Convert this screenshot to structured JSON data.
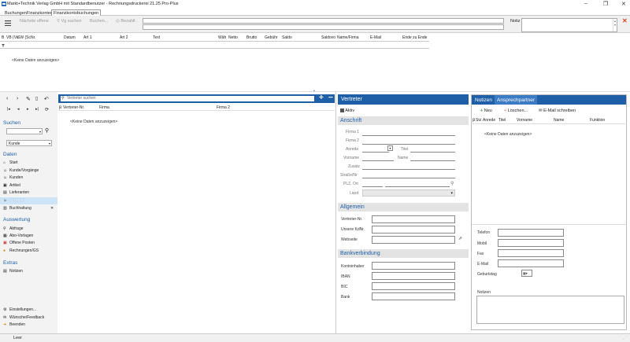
{
  "window": {
    "title": "Markt+Technik Verlag GmbH mit Standardbenutzer  -  Rechnungsdruckerei 21.25 Pro-Plus",
    "minimize": "–",
    "maximize": "❐",
    "close": "✕"
  },
  "tabs": [
    "Buchungen",
    "Finanzkonten",
    "Finanzkontobuchungen"
  ],
  "toolbar": {
    "next_open": "Nächste offene",
    "search_vg": "Vg suchen",
    "search": "Buchen...",
    "paid": "Bezahlt",
    "notes_label": "Notiz"
  },
  "grid": {
    "columns": [
      "B",
      "VB (Ve",
      "SW (Sc",
      "Nr.",
      "Datum",
      "Art 1",
      "Art 2",
      "Text",
      "Wäh",
      "Netto",
      "Brutto",
      "Gebühr",
      "Saldo",
      "Saldovo",
      "Name/Firma",
      "E-Mail",
      "Ende zu Ende"
    ],
    "empty": "<Keine Daten anzuzeigen>"
  },
  "nav": {
    "search_heading": "Suchen",
    "search_scope": "Kunde",
    "data_heading": "Daten",
    "data_items": [
      "Start",
      "Kunde/Vorgänge",
      "Kunden",
      "Artikel",
      "Lieferanten",
      "Vertreter",
      "Buchhaltung"
    ],
    "eval_heading": "Auswertung",
    "eval_items": [
      "Abfrage",
      "Abo-Vorlagen",
      "Offene Posten",
      "Rechnungen/GS"
    ],
    "extras_heading": "Extras",
    "extras_items": [
      "Notizen"
    ],
    "bottom_items": [
      "Einstellungen...",
      "Wünsche/Feedback",
      "Beenden"
    ]
  },
  "list": {
    "search_placeholder": "Vertreter suchen",
    "columns": [
      "Vertreter-Nr.",
      "Firma",
      "Firma 2"
    ],
    "empty": "<Keine Daten anzuzeigen>"
  },
  "detail": {
    "header": "Vertreter",
    "active_label": "Aktiv",
    "address_heading": "Anschrift",
    "fields": {
      "firma1": "Firma 1",
      "firma2": "Firma 2",
      "anrede": "Anrede",
      "titel": "Titel",
      "vorname": "Vorname",
      "name": "Name",
      "zusatz": "Zusatz",
      "strasse": "Straße/Nr",
      "plz": "PLZ, Ort",
      "land": "Land"
    },
    "general_heading": "Allgemein",
    "general_fields": [
      "Vertreter-Nr.",
      "Unsere KdNr.",
      "Webseite"
    ],
    "bank_heading": "Bankverbindung",
    "bank_fields": [
      "Kontoinhaber",
      "IBAN",
      "BIC",
      "Bank"
    ]
  },
  "contacts": {
    "tab_notes": "Notizen",
    "tab_contacts": "Ansprechpartner",
    "new": "Neu",
    "delete": "Löschen...",
    "email": "E-Mail schreiben",
    "columns": [
      "Stz",
      "Anrede",
      "Titel",
      "Vorname",
      "Name",
      "Funktion"
    ],
    "empty": "<Keine Daten anzuzeigen>",
    "fields": [
      "Telefon",
      "Mobil",
      "Fax",
      "E-Mail",
      "Geburtstag"
    ],
    "notes_label": "Notizen"
  },
  "status": {
    "text": "Leer"
  },
  "colors": {
    "accent": "#1e5fa8",
    "selection": "#cde4f7",
    "close_red": "#d9412b"
  }
}
